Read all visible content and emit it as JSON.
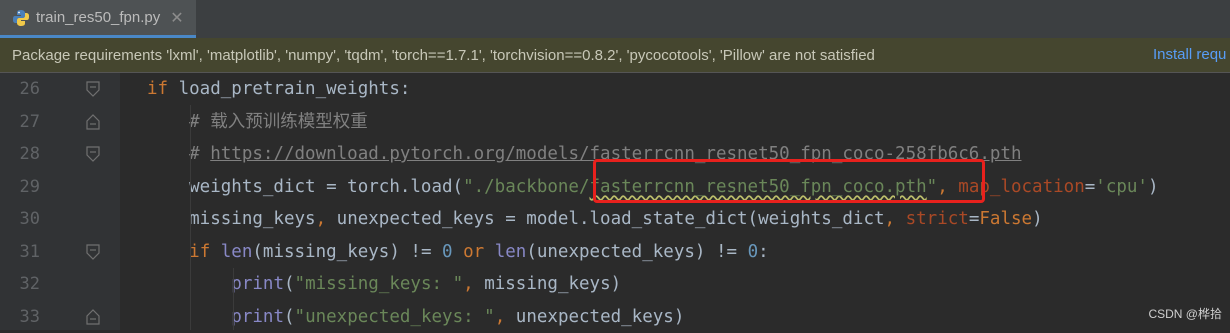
{
  "tab": {
    "label": "train_res50_fpn.py",
    "close": "✕"
  },
  "banner": {
    "message": "Package requirements 'lxml', 'matplotlib', 'numpy', 'tqdm', 'torch==1.7.1', 'torchvision==0.8.2', 'pycocotools', 'Pillow' are not satisfied",
    "action": "Install requ"
  },
  "lines": [
    {
      "num": "26",
      "tokens": [
        {
          "t": "if ",
          "c": "kw"
        },
        {
          "t": "load_pretrain_weights:",
          "c": ""
        }
      ]
    },
    {
      "num": "27",
      "tokens": [
        {
          "t": "    # 载入预训练模型权重",
          "c": "cm"
        }
      ]
    },
    {
      "num": "28",
      "tokens": [
        {
          "t": "    # ",
          "c": "cm"
        },
        {
          "t": "https://download.pytorch.org/models/fasterrcnn_resnet50_fpn_coco-258fb6c6.pth",
          "c": "url"
        }
      ]
    },
    {
      "num": "29",
      "tokens": [
        {
          "t": "    weights_dict = torch.load(",
          "c": ""
        },
        {
          "t": "\"./backbone/",
          "c": "str"
        },
        {
          "t": "fasterrcnn_resnet50_fpn_coco.pth",
          "c": "str squig"
        },
        {
          "t": "\"",
          "c": "str"
        },
        {
          "t": ", ",
          "c": "kw"
        },
        {
          "t": "map_location",
          "c": "par"
        },
        {
          "t": "=",
          "c": ""
        },
        {
          "t": "'cpu'",
          "c": "str"
        },
        {
          "t": ")",
          "c": ""
        }
      ]
    },
    {
      "num": "30",
      "tokens": [
        {
          "t": "    missing_keys",
          "c": ""
        },
        {
          "t": ", ",
          "c": "kw"
        },
        {
          "t": "unexpected_keys = model.load_state_dict(weights_dict",
          "c": ""
        },
        {
          "t": ", ",
          "c": "kw"
        },
        {
          "t": "strict",
          "c": "par"
        },
        {
          "t": "=",
          "c": ""
        },
        {
          "t": "False",
          "c": "kw"
        },
        {
          "t": ")",
          "c": ""
        }
      ]
    },
    {
      "num": "31",
      "tokens": [
        {
          "t": "    ",
          "c": ""
        },
        {
          "t": "if ",
          "c": "kw"
        },
        {
          "t": "len",
          "c": "bi"
        },
        {
          "t": "(missing_keys) != ",
          "c": ""
        },
        {
          "t": "0 ",
          "c": "num"
        },
        {
          "t": "or ",
          "c": "kw"
        },
        {
          "t": "len",
          "c": "bi"
        },
        {
          "t": "(unexpected_keys) != ",
          "c": ""
        },
        {
          "t": "0",
          "c": "num"
        },
        {
          "t": ":",
          "c": ""
        }
      ]
    },
    {
      "num": "32",
      "tokens": [
        {
          "t": "        ",
          "c": ""
        },
        {
          "t": "print",
          "c": "bi"
        },
        {
          "t": "(",
          "c": ""
        },
        {
          "t": "\"missing_keys: \"",
          "c": "str"
        },
        {
          "t": ", ",
          "c": "kw"
        },
        {
          "t": "missing_keys)",
          "c": ""
        }
      ]
    },
    {
      "num": "33",
      "tokens": [
        {
          "t": "        ",
          "c": ""
        },
        {
          "t": "print",
          "c": "bi"
        },
        {
          "t": "(",
          "c": ""
        },
        {
          "t": "\"unexpected_keys: \"",
          "c": "str"
        },
        {
          "t": ", ",
          "c": "kw"
        },
        {
          "t": "unexpected_keys)",
          "c": ""
        }
      ]
    }
  ],
  "watermark": "CSDN @桦拾",
  "colors": {
    "accent": "#4a88c7",
    "highlight_box": "#e8211d",
    "banner_bg": "#45462f"
  }
}
